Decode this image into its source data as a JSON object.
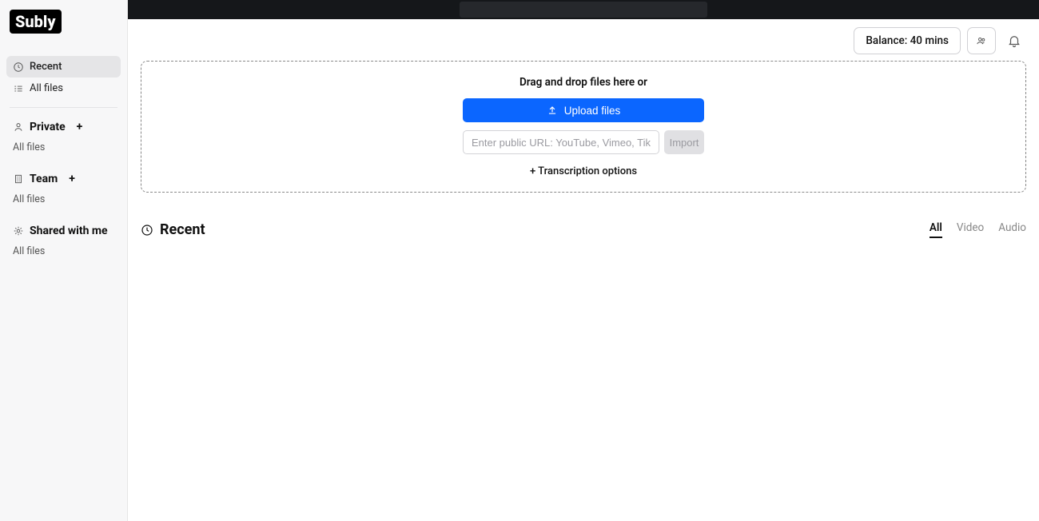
{
  "logo": "Subly",
  "sidebar": {
    "recent": "Recent",
    "all_files": "All files",
    "private": {
      "label": "Private",
      "all_files": "All files"
    },
    "team": {
      "label": "Team",
      "all_files": "All files"
    },
    "shared": {
      "label": "Shared with me",
      "all_files": "All files"
    }
  },
  "header": {
    "balance": "Balance: 40 mins"
  },
  "dropzone": {
    "text": "Drag and drop files here or",
    "upload_btn": "Upload files",
    "url_placeholder": "Enter public URL: YouTube, Vimeo, TikTok...",
    "import_btn": "Import",
    "transcription_options": "+ Transcription options"
  },
  "section": {
    "title": "Recent",
    "tabs": {
      "all": "All",
      "video": "Video",
      "audio": "Audio"
    }
  }
}
